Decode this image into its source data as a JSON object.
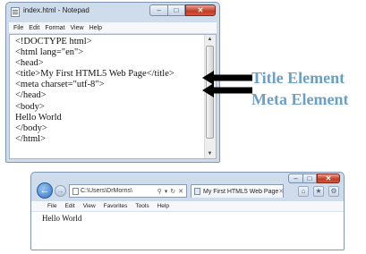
{
  "notepad": {
    "title": "index.html - Notepad",
    "menu": [
      "File",
      "Edit",
      "Format",
      "View",
      "Help"
    ],
    "lines": [
      "<!DOCTYPE html>",
      "<html lang=\"en\">",
      "<head>",
      "<title>My First HTML5 Web Page</title>",
      "<meta charset=\"utf-8\">",
      "</head>",
      "<body>",
      "Hello World",
      "</body>",
      "</html>"
    ]
  },
  "callouts": {
    "title_element": "Title Element",
    "meta_element": "Meta Element",
    "color": "#6aa0c7",
    "arrow_color": "#000000"
  },
  "browser": {
    "address": "C:\\Users\\DrMorris\\",
    "tab_title": "My First HTML5 Web Page",
    "menu": [
      "File",
      "Edit",
      "View",
      "Favorites",
      "Tools",
      "Help"
    ],
    "content_text": "Hello World"
  },
  "icons": {
    "notepad_icon": "notepad-app-icon",
    "back": "back-arrow-icon",
    "forward": "forward-arrow-icon",
    "home": "home-icon",
    "favorites": "star-icon",
    "settings": "gear-icon"
  }
}
